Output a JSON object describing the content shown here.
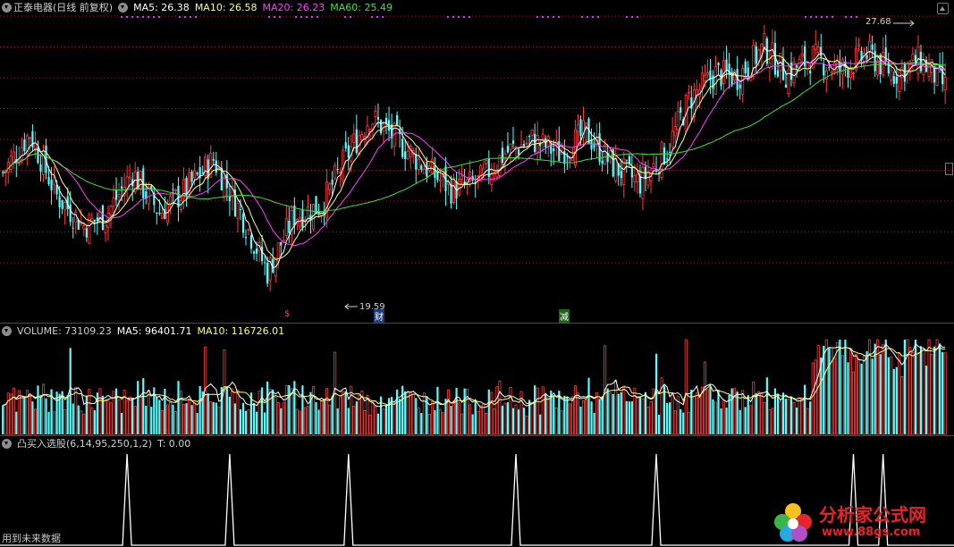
{
  "price_header": {
    "title": "正泰电器(日线 前复权)",
    "ma5": "MA5: 26.38",
    "ma10": "MA10: 26.58",
    "ma20": "MA20: 26.23",
    "ma60": "MA60: 25.49"
  },
  "price_annotations": {
    "high": "27.68",
    "low": "19.59",
    "markers": [
      "$",
      "财",
      "减"
    ]
  },
  "volume_header": {
    "volume": "VOLUME: 73109.23",
    "ma5": "MA5: 96401.71",
    "ma10": "MA10: 116726.01"
  },
  "indicator_header": {
    "title": "凸买入选股(6,14,95,250,1,2)",
    "value": "T: 0.00"
  },
  "footer": "用到未来数据",
  "watermark": {
    "title": "分析家公式网",
    "url": "www.88gs.com"
  },
  "colors": {
    "up": "#ff3c3c",
    "down": "#54ffff",
    "ma5": "#ffffff",
    "ma10": "#ffff80",
    "ma20": "#ff40ff",
    "ma60": "#40e040",
    "grid": "#901818"
  },
  "chart_data": [
    {
      "type": "candlestick",
      "series": [
        {
          "name": "MA5",
          "values": [
            26.38
          ]
        },
        {
          "name": "MA10",
          "values": [
            26.58
          ]
        },
        {
          "name": "MA20",
          "values": [
            26.23
          ]
        },
        {
          "name": "MA60",
          "values": [
            25.49
          ]
        }
      ],
      "ylim": [
        19.0,
        28.2
      ],
      "annotations": [
        {
          "text": "27.68",
          "y": 27.68
        },
        {
          "text": "19.59",
          "y": 19.59
        }
      ],
      "grid": true,
      "anchors": [
        [
          0,
          23.4
        ],
        [
          10,
          24.6
        ],
        [
          20,
          22.7
        ],
        [
          30,
          21.8
        ],
        [
          38,
          22.1
        ],
        [
          48,
          23.4
        ],
        [
          58,
          22.2
        ],
        [
          68,
          22.9
        ],
        [
          78,
          23.8
        ],
        [
          88,
          22.2
        ],
        [
          98,
          20.4
        ],
        [
          108,
          22.1
        ],
        [
          118,
          22.4
        ],
        [
          128,
          24.0
        ],
        [
          136,
          25.1
        ],
        [
          146,
          24.4
        ],
        [
          156,
          23.6
        ],
        [
          166,
          22.9
        ],
        [
          176,
          23.1
        ],
        [
          186,
          24.0
        ],
        [
          196,
          24.4
        ],
        [
          206,
          24.0
        ],
        [
          216,
          24.6
        ],
        [
          226,
          23.6
        ],
        [
          236,
          23.1
        ],
        [
          246,
          24.1
        ],
        [
          254,
          25.6
        ],
        [
          264,
          26.4
        ],
        [
          272,
          26.3
        ],
        [
          282,
          27.2
        ],
        [
          290,
          26.4
        ],
        [
          300,
          26.9
        ],
        [
          310,
          26.5
        ],
        [
          320,
          27.0
        ],
        [
          330,
          26.4
        ],
        [
          340,
          26.8
        ],
        [
          349,
          26.0
        ]
      ]
    },
    {
      "type": "bar",
      "series": [
        {
          "name": "VOLUME",
          "values": [
            73109.23
          ]
        },
        {
          "name": "MA5",
          "values": [
            96401.71
          ]
        },
        {
          "name": "MA10",
          "values": [
            116726.01
          ]
        }
      ]
    },
    {
      "type": "line",
      "series": [
        {
          "name": "T",
          "values": [
            0.0
          ]
        }
      ],
      "ylim": [
        0,
        1
      ],
      "spike_positions": [
        46,
        84,
        128,
        190,
        242,
        315,
        326
      ]
    }
  ]
}
